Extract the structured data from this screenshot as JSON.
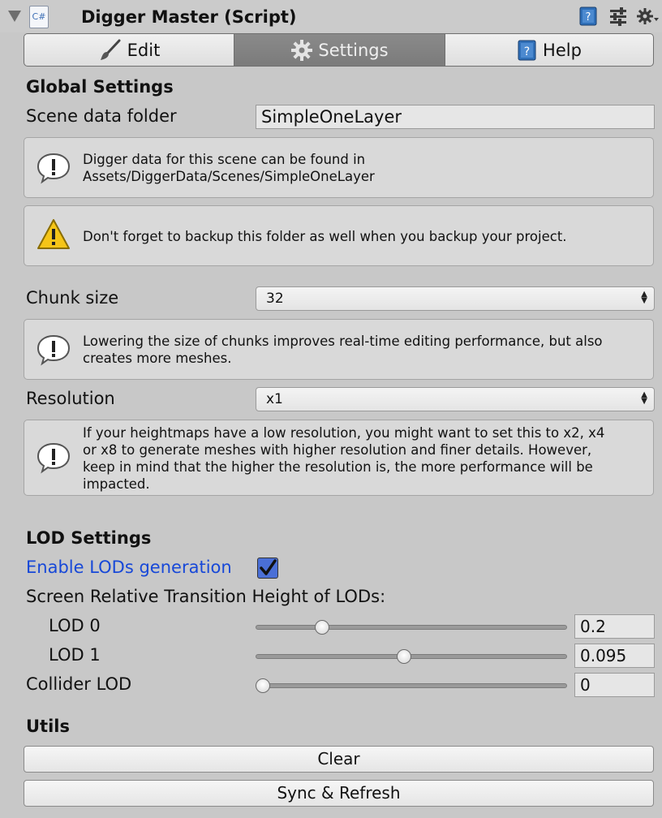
{
  "header": {
    "script_icon_text": "C#",
    "title": "Digger Master (Script)"
  },
  "tabs": [
    {
      "label": "Edit",
      "icon": "brush-icon",
      "active": false
    },
    {
      "label": "Settings",
      "icon": "gear-icon",
      "active": true
    },
    {
      "label": "Help",
      "icon": "help-book-icon",
      "active": false
    }
  ],
  "global": {
    "title": "Global Settings",
    "scene_data_folder_label": "Scene data folder",
    "scene_data_folder_value": "SimpleOneLayer",
    "info_folder_line1": "Digger data for this scene can be found in",
    "info_folder_line2": "Assets/DiggerData/Scenes/SimpleOneLayer",
    "warning_backup": "Don't forget to backup this folder as well when you backup your project.",
    "chunk_size_label": "Chunk size",
    "chunk_size_value": "32",
    "info_chunk_line1": "Lowering the size of chunks improves real-time editing performance, but also",
    "info_chunk_line2": "creates more meshes.",
    "resolution_label": "Resolution",
    "resolution_value": "x1",
    "info_res_line1": "If your heightmaps have a low resolution, you might want to set this to x2, x4",
    "info_res_line2": "or x8 to generate meshes with higher resolution and finer details. However,",
    "info_res_line3": "keep in mind that the higher the resolution is, the more performance will be",
    "info_res_line4": "impacted."
  },
  "lod": {
    "title": "LOD Settings",
    "enable_label": "Enable LODs generation",
    "enable_checked": true,
    "transition_label": "Screen Relative Transition Height of LODs:",
    "lod0_label": "LOD 0",
    "lod0_value": "0.2",
    "lod0_fraction": 0.2,
    "lod1_label": "LOD 1",
    "lod1_value": "0.095",
    "lod1_fraction": 0.475,
    "collider_label": "Collider LOD",
    "collider_value": "0",
    "collider_fraction": 0
  },
  "utils": {
    "title": "Utils",
    "clear_label": "Clear",
    "sync_label": "Sync & Refresh"
  },
  "colors": {
    "link": "#1748d8",
    "accent": "#4a6fd6",
    "active_tab": "#7f7f7f"
  }
}
